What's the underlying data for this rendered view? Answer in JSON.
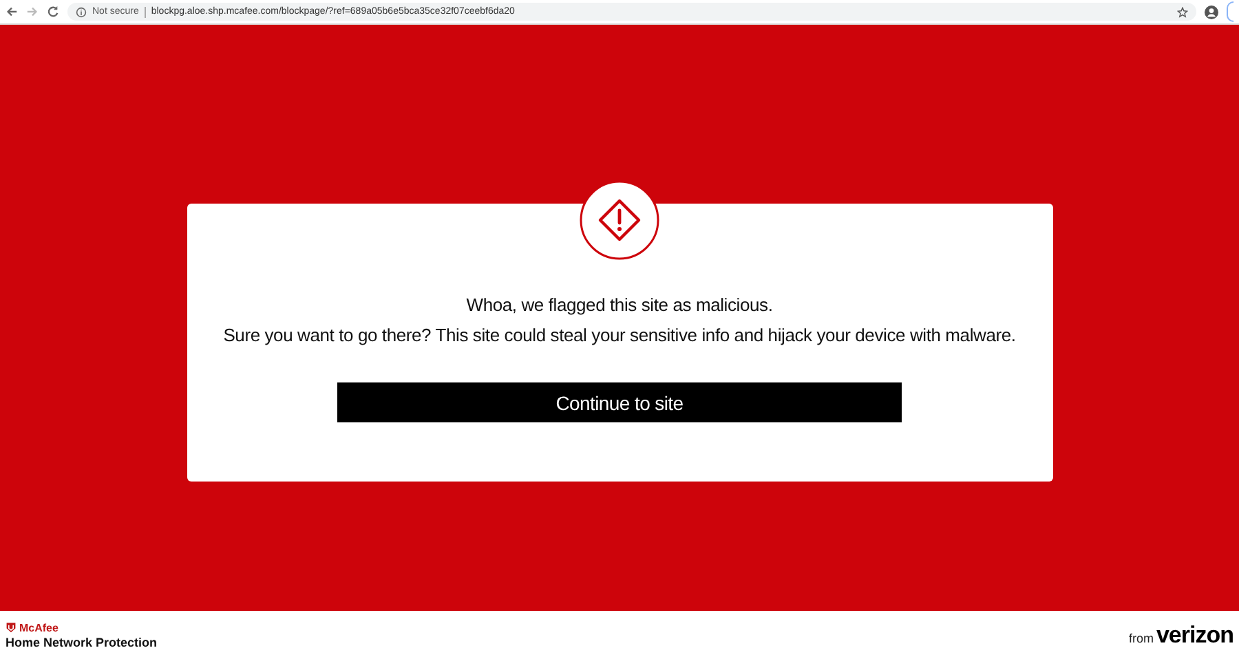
{
  "browser": {
    "security_label": "Not secure",
    "url": "blockpg.aloe.shp.mcafee.com/blockpage/?ref=689a05b6e5bca35ce32f07ceebf6da20"
  },
  "warning": {
    "headline": "Whoa, we flagged this site as malicious.",
    "message": "Sure you want to go there? This site could steal your sensitive info and hijack your device with malware.",
    "button": "Continue to site"
  },
  "footer": {
    "brand": "McAfee",
    "product": "Home Network Protection",
    "from_label": "from",
    "partner": "verizon"
  }
}
